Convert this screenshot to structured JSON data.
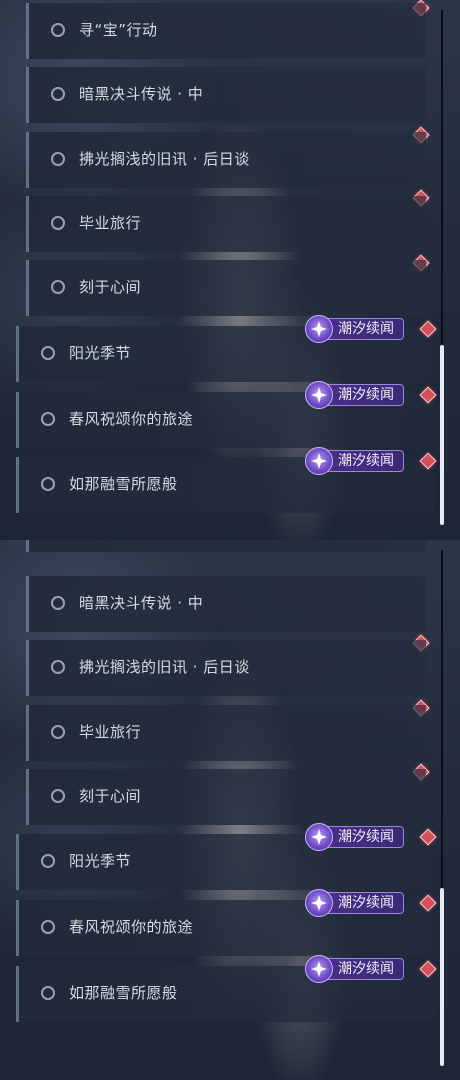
{
  "top_list": {
    "items": [
      {
        "label": "寻“宝”行动"
      },
      {
        "label": "暗黑决斗传说 · 中"
      },
      {
        "label": "拂光搁浅的旧讯 · 后日谈"
      },
      {
        "label": "毕业旅行"
      },
      {
        "label": "刻于心间"
      },
      {
        "label": "阳光季节",
        "badge": "潮汐续闻"
      },
      {
        "label": "春风祝颂你的旅途",
        "badge": "潮汐续闻"
      },
      {
        "label": "如那融雪所愿般",
        "badge": "潮汐续闻"
      }
    ]
  },
  "bottom_list": {
    "items": [
      {
        "label": "暗黑决斗传说 · 中"
      },
      {
        "label": "拂光搁浅的旧讯 · 后日谈"
      },
      {
        "label": "毕业旅行"
      },
      {
        "label": "刻于心间"
      },
      {
        "label": "阳光季节",
        "badge": "潮汐续闻"
      },
      {
        "label": "春风祝颂你的旅途",
        "badge": "潮汐续闻"
      },
      {
        "label": "如那融雪所愿般",
        "badge": "潮汐续闻"
      }
    ]
  },
  "colors": {
    "badge_purple": "#4b2f8c",
    "notification_red": "#d4505c",
    "item_accent": "#5c7387"
  },
  "icons": {
    "radio": "circle-outline-icon",
    "new": "red-diamond-icon",
    "badge": "sparkle-star-icon"
  }
}
